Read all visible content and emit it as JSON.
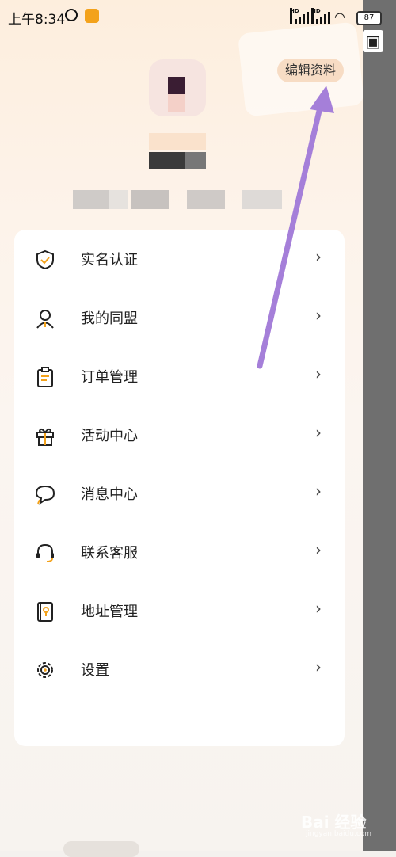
{
  "status_bar": {
    "time": "上午8:34",
    "battery": "87"
  },
  "header": {
    "edit_label": "编辑资料"
  },
  "menu": [
    {
      "label": "实名认证",
      "icon": "shield-check-icon"
    },
    {
      "label": "我的同盟",
      "icon": "person-icon"
    },
    {
      "label": "订单管理",
      "icon": "clipboard-icon"
    },
    {
      "label": "活动中心",
      "icon": "gift-icon"
    },
    {
      "label": "消息中心",
      "icon": "chat-bubble-icon"
    },
    {
      "label": "联系客服",
      "icon": "headset-icon"
    },
    {
      "label": "地址管理",
      "icon": "address-book-icon"
    },
    {
      "label": "设置",
      "icon": "gear-icon"
    }
  ],
  "colors": {
    "accent": "#f3a21b",
    "arrow": "#a57fd9",
    "overlay": "#6f6f6f"
  },
  "watermark": {
    "text": "Bai 经验",
    "sub": "jingyan.baidu.com"
  }
}
